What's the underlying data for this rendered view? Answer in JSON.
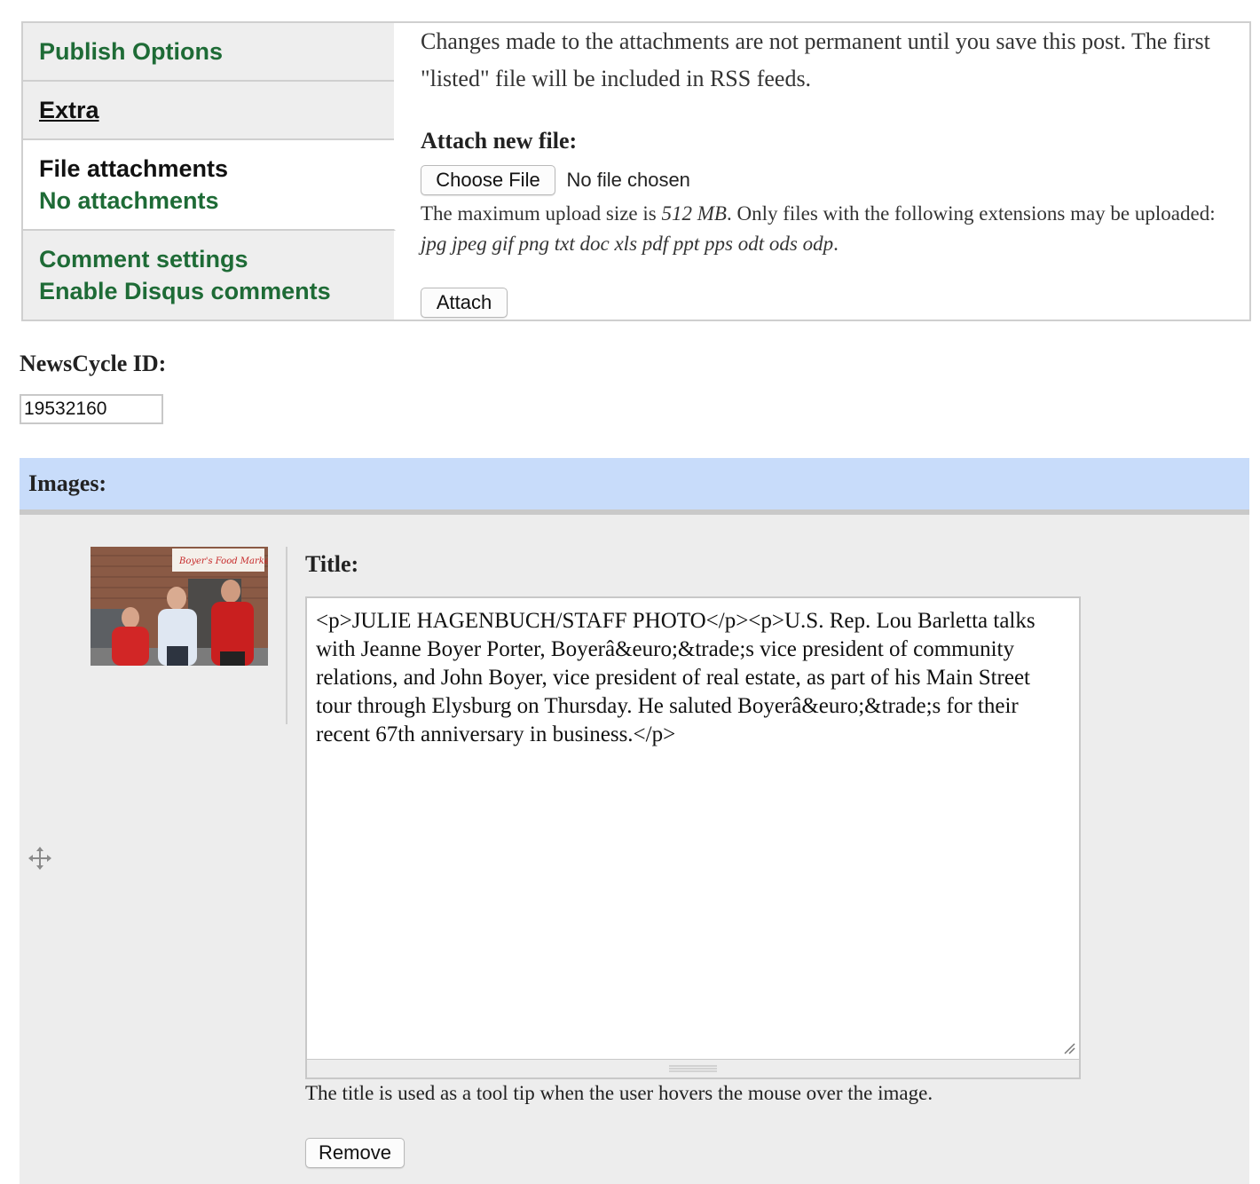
{
  "tabs": [
    {
      "title": "Publish Options"
    },
    {
      "title": "Extra"
    },
    {
      "title": "File attachments",
      "summary": "No attachments"
    },
    {
      "title": "Comment settings",
      "summary": "Enable Disqus comments"
    }
  ],
  "attachments": {
    "notice": "Changes made to the attachments are not permanent until you save this post. The first \"listed\" file will be included in RSS feeds.",
    "attach_label": "Attach new file:",
    "choose_file_label": "Choose File",
    "no_file_text": "No file chosen",
    "help_prefix": "The maximum upload size is ",
    "max_size": "512 MB",
    "help_middle": ". Only files with the following extensions may be uploaded: ",
    "extensions": "jpg jpeg gif png txt doc xls pdf ppt pps odt ods odp",
    "help_suffix": ".",
    "attach_button": "Attach"
  },
  "newscycle": {
    "label": "NewsCycle ID:",
    "value": "19532160"
  },
  "images": {
    "header": "Images:",
    "title_label": "Title:",
    "title_value": "<p>JULIE HAGENBUCH/STAFF PHOTO</p><p>U.S. Rep. Lou Barletta talks with Jeanne Boyer Porter, Boyerâ&euro;&trade;s vice president of community relations, and John Boyer, vice president of real estate, as part of his Main Street tour through Elysburg on Thursday. He saluted Boyerâ&euro;&trade;s for their recent 67th anniversary in business.</p>",
    "description": "The title is used as a tool tip when the user hovers the mouse over the image.",
    "remove_button": "Remove",
    "thumbnail_sign_text": "Boyer's Food Markets"
  },
  "colors": {
    "tab_link": "#1e6b36",
    "images_header_bg": "#c8dcfa",
    "images_body_bg": "#ededed"
  }
}
